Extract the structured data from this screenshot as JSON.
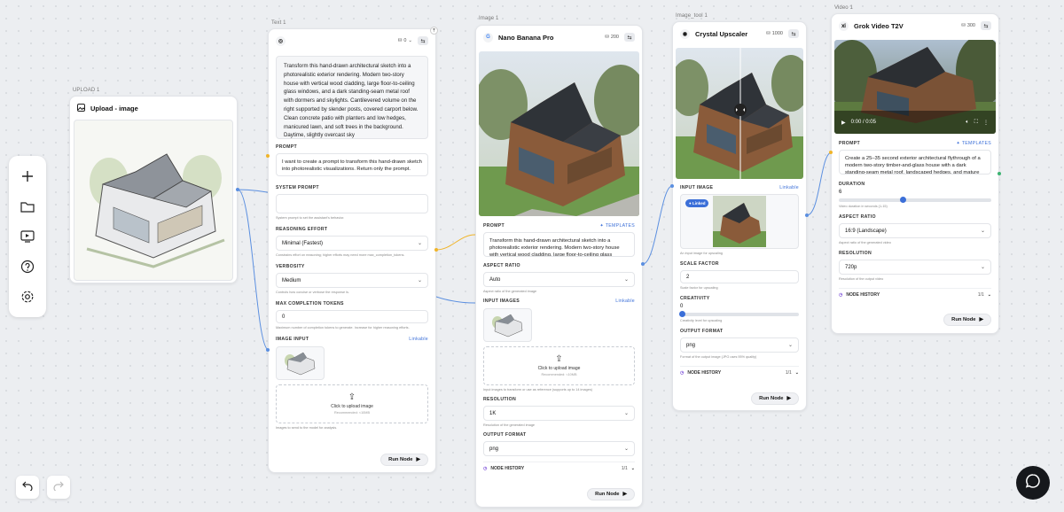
{
  "upload": {
    "tag": "UPLOAD 1",
    "title": "Upload - image"
  },
  "text": {
    "tag": "Text 1",
    "cost": "0",
    "output": "Transform this hand-drawn architectural sketch into a photorealistic exterior rendering. Modern two-story house with vertical wood cladding, large floor-to-ceiling glass windows, and a dark standing-seam metal roof with dormers and skylights. Cantilevered volume on the right supported by slender posts, covered carport below. Clean concrete patio with planters and low hedges, manicured lawn, and soft trees in the background. Daytime, slightly overcast sky",
    "prompt_label": "PROMPT",
    "prompt": "I want to create a prompt to transform this hand-drawn sketch into photorealistic visualizations. Return only the prompt.",
    "system_label": "SYSTEM PROMPT",
    "system_hint": "System prompt to set the assistant's behavior.",
    "reasoning_label": "REASONING EFFORT",
    "reasoning_value": "Minimal (Fastest)",
    "reasoning_hint": "Constrains effort on reasoning; higher efforts may need more max_completion_tokens.",
    "verbosity_label": "VERBOSITY",
    "verbosity_value": "Medium",
    "verbosity_hint": "Controls how concise or verbose the response is.",
    "max_label": "MAX COMPLETION TOKENS",
    "max_value": "0",
    "max_hint": "Maximum number of completion tokens to generate. Increase for higher reasoning efforts.",
    "image_label": "IMAGE INPUT",
    "linkable": "Linkable",
    "upload_text": "Click to upload image",
    "upload_sub": "Recommended: <10MB",
    "image_hint": "Images to send to the model for analysis.",
    "run": "Run Node"
  },
  "image": {
    "tag": "Image 1",
    "title": "Nano Banana Pro",
    "cost": "200",
    "prompt_label": "PROMPT",
    "templates": "TEMPLATES",
    "prompt": "Transform this hand-drawn architectural sketch into a photorealistic exterior rendering. Modern two-story house with vertical wood cladding, large floor-to-ceiling glass windows,",
    "aspect_label": "ASPECT RATIO",
    "aspect_value": "Auto",
    "aspect_hint": "Aspect ratio of the generated image",
    "inputs_label": "INPUT IMAGES",
    "linkable": "Linkable",
    "upload_text": "Click to upload image",
    "upload_sub": "Recommended: <10MB",
    "inputs_hint": "Input images to transform or use as reference (supports up to 14 images)",
    "res_label": "RESOLUTION",
    "res_value": "1K",
    "res_hint": "Resolution of the generated image",
    "fmt_label": "OUTPUT FORMAT",
    "fmt_value": "png",
    "history": "NODE HISTORY",
    "history_count": "1/1",
    "run": "Run Node"
  },
  "upscale": {
    "tag": "Image_tool 1",
    "title": "Crystal Upscaler",
    "cost": "1000",
    "input_label": "INPUT IMAGE",
    "linkable": "Linkable",
    "linked": "Linked",
    "input_hint": "An input image for upscaling",
    "scale_label": "SCALE FACTOR",
    "scale_value": "2",
    "scale_hint": "Scale factor for upscaling",
    "creativity_label": "CREATIVITY",
    "creativity_value": "0",
    "creativity_hint": "Creativity level for upscaling",
    "fmt_label": "OUTPUT FORMAT",
    "fmt_value": "png",
    "fmt_hint": "Format of the output image (JPG uses 95% quality)",
    "history": "NODE HISTORY",
    "history_count": "1/1",
    "run": "Run Node"
  },
  "video": {
    "tag": "Video 1",
    "title": "Grok Video T2V",
    "cost": "300",
    "time": "0:00 / 0:05",
    "prompt_label": "PROMPT",
    "templates": "TEMPLATES",
    "prompt": "Create a 25–35 second exterior architectural flythrough of a modern two-story timber-and-glass house with a dark standing-seam metal roof, landscaped hedges, and mature",
    "duration_label": "DURATION",
    "duration_value": "6",
    "duration_fraction": 0.4,
    "duration_hint": "Video duration in seconds (1-15)",
    "aspect_label": "ASPECT RATIO",
    "aspect_value": "16:9 (Landscape)",
    "aspect_hint": "Aspect ratio of the generated video",
    "res_label": "RESOLUTION",
    "res_value": "720p",
    "res_hint": "Resolution of the output video",
    "history": "NODE HISTORY",
    "history_count": "1/1",
    "run": "Run Node"
  },
  "colors": {
    "accent": "#3b6fd8",
    "wire_blue": "#5b8fe0",
    "wire_yellow": "#f0b429"
  }
}
